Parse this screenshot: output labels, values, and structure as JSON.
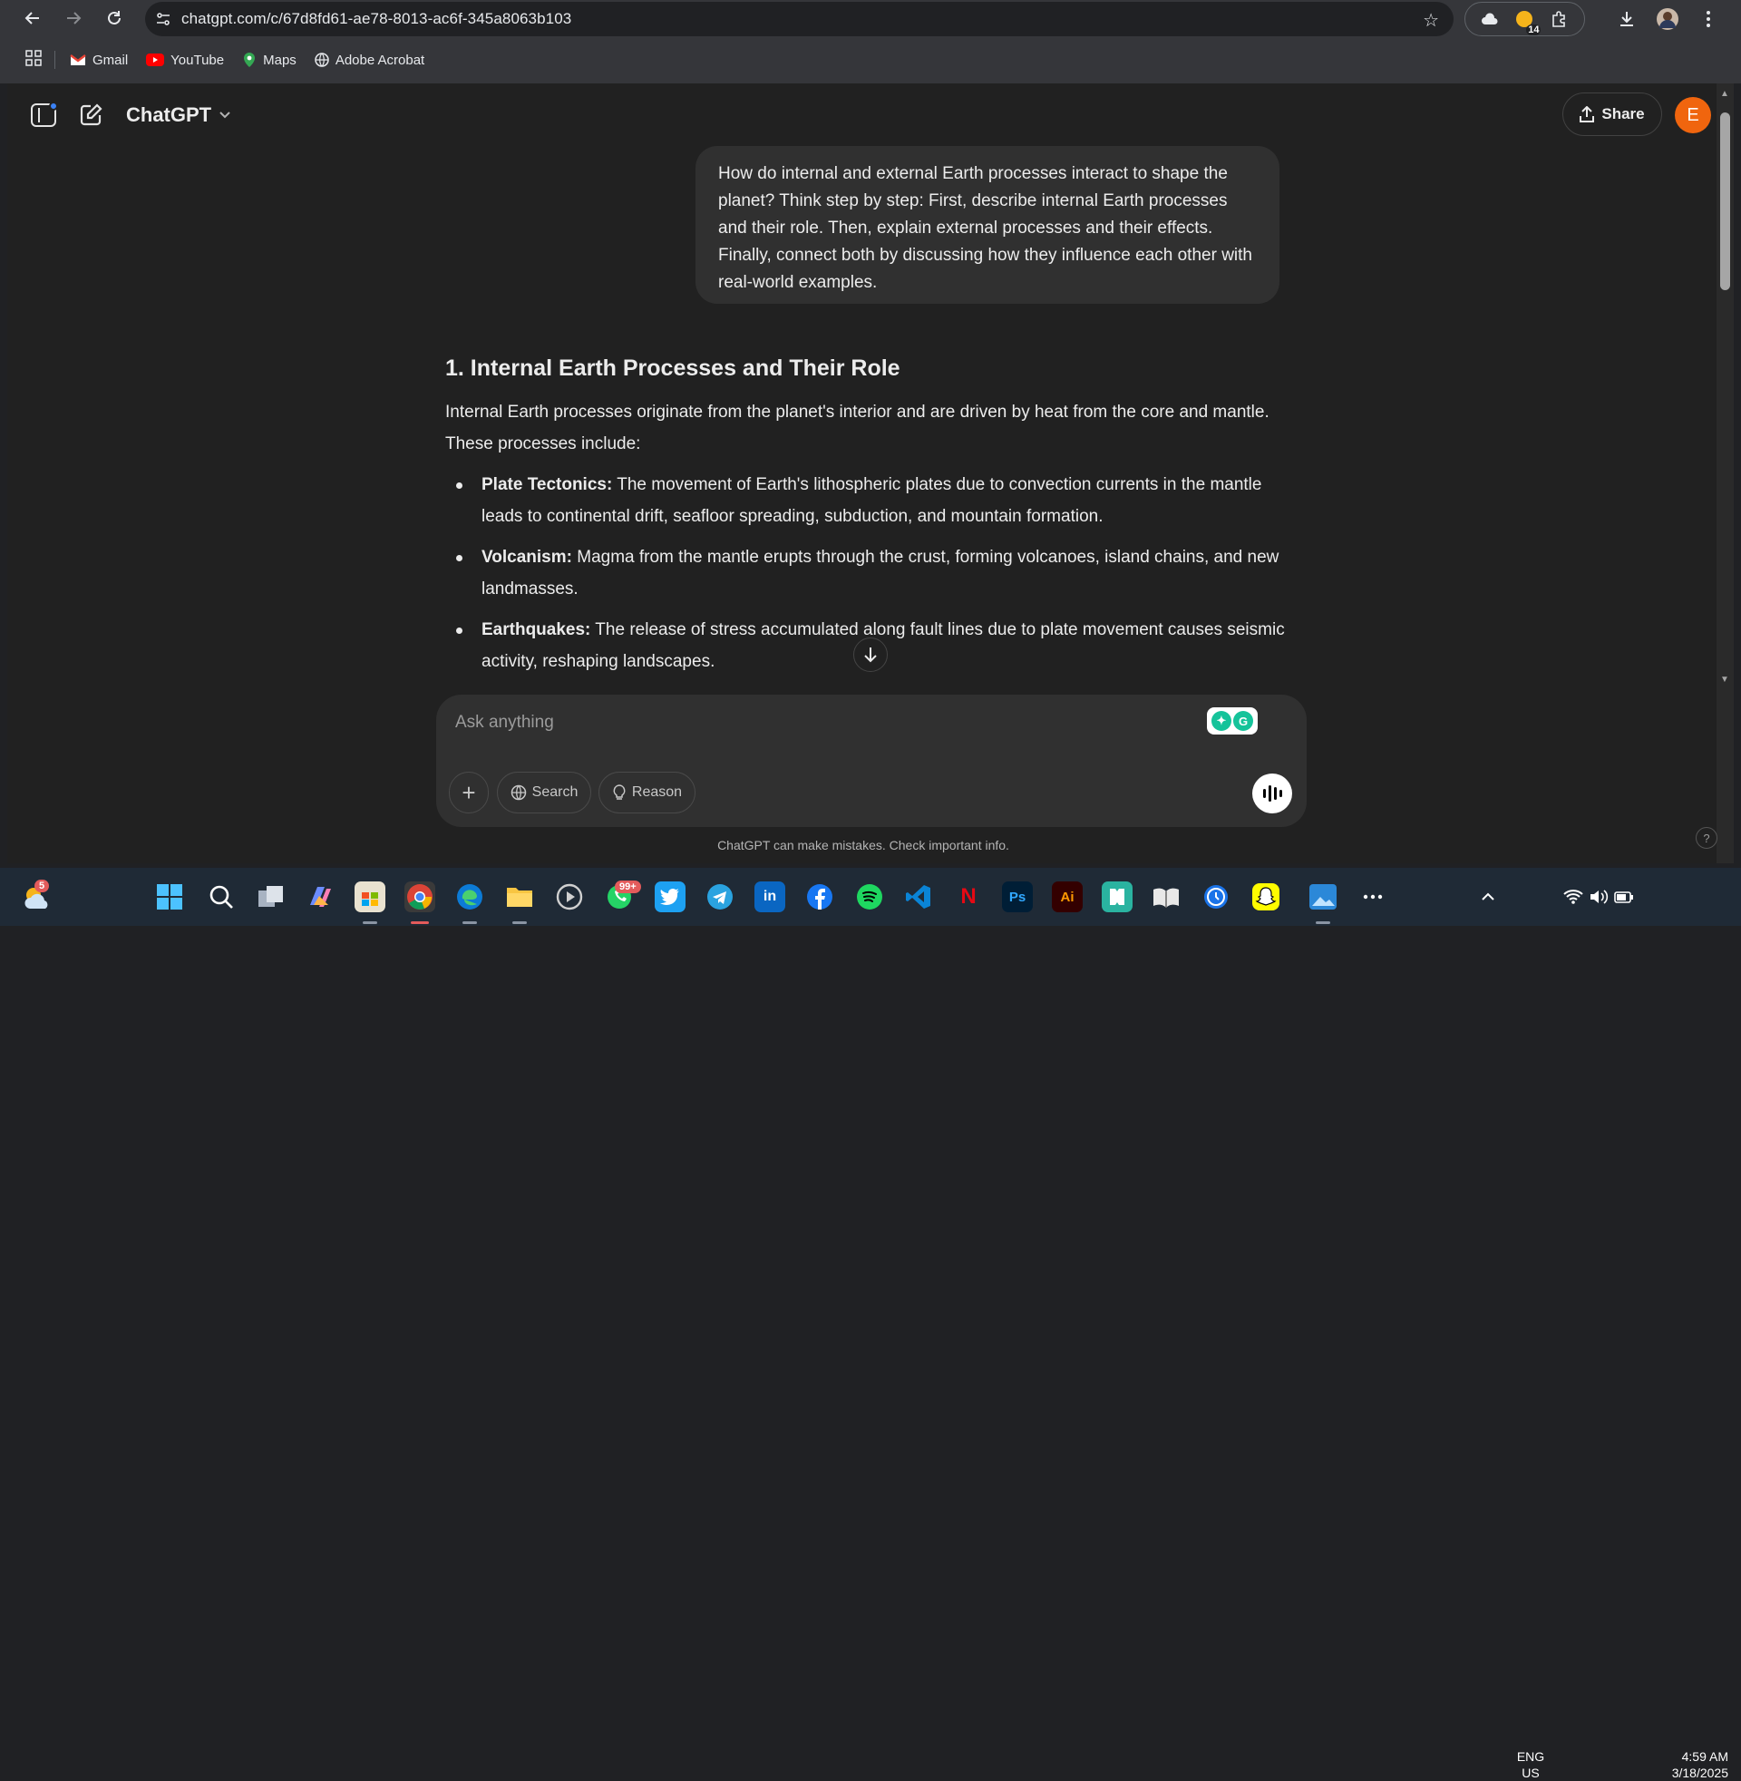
{
  "browser": {
    "url": "chatgpt.com/c/67d8fd61-ae78-8013-ac6f-345a8063b103",
    "extension_badge": "14",
    "bookmarks": [
      "Gmail",
      "YouTube",
      "Maps",
      "Adobe Acrobat"
    ]
  },
  "header": {
    "model_name": "ChatGPT",
    "share_label": "Share",
    "avatar_letter": "E"
  },
  "conversation": {
    "user_message": "How do internal and external Earth processes interact to shape the planet? Think step by step: First, describe internal Earth processes and their role. Then, explain external processes and their effects. Finally, connect both by discussing how they influence each other with real-world examples.",
    "heading": "1. Internal Earth Processes and Their Role",
    "intro": "Internal Earth processes originate from the planet's interior and are driven by heat from the core and mantle. These processes include:",
    "bullets": [
      {
        "term": "Plate Tectonics:",
        "text": " The movement of Earth's lithospheric plates due to convection currents in the mantle leads to continental drift, seafloor spreading, subduction, and mountain formation."
      },
      {
        "term": "Volcanism:",
        "text": " Magma from the mantle erupts through the crust, forming volcanoes, island chains, and new landmasses."
      },
      {
        "term": "Earthquakes:",
        "text": " The release of stress accumulated along fault lines due to plate movement causes seismic activity, reshaping landscapes."
      }
    ]
  },
  "composer": {
    "placeholder": "Ask anything",
    "plus_label": "+",
    "search_label": "Search",
    "reason_label": "Reason"
  },
  "disclaimer": "ChatGPT can make mistakes. Check important info.",
  "help_label": "?",
  "taskbar": {
    "weather_badge": "5",
    "whatsapp_badge": "99+",
    "lang_top": "ENG",
    "lang_bottom": "US",
    "time": "4:59 AM",
    "date": "3/18/2025"
  }
}
